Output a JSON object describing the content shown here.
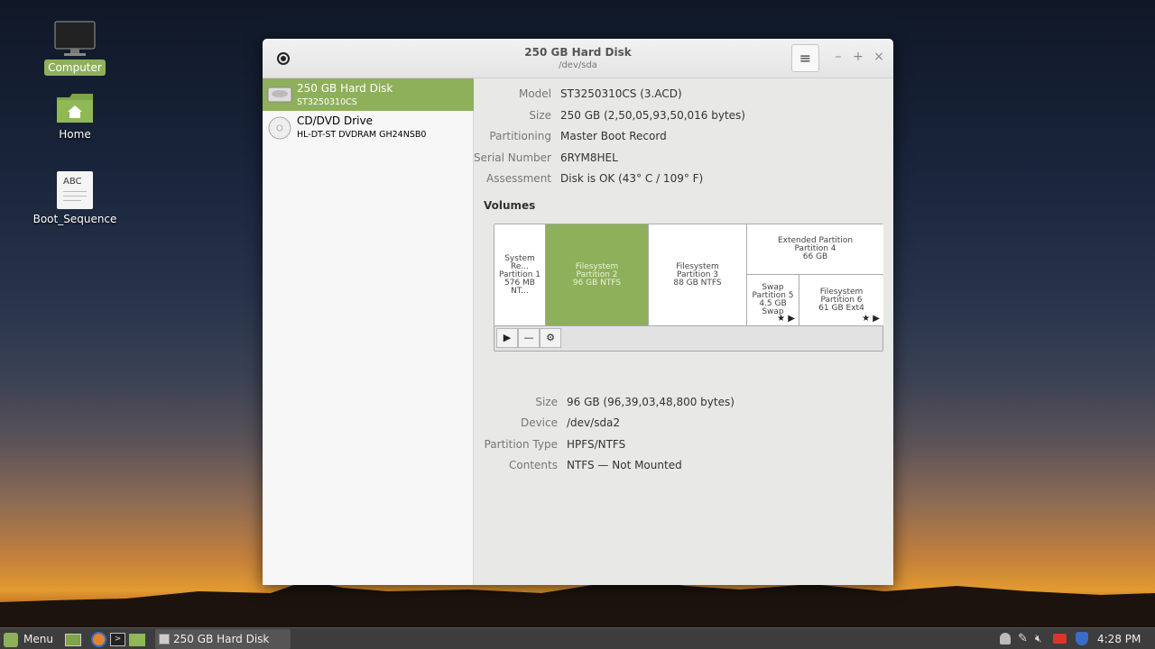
{
  "desktop": {
    "icons": [
      {
        "label": "Computer",
        "icon": "monitor-icon"
      },
      {
        "label": "Home",
        "icon": "home-folder-icon"
      },
      {
        "label": "Boot_Sequence",
        "icon": "text-file-icon",
        "thumb": "ABC"
      }
    ]
  },
  "window": {
    "title": "250 GB Hard Disk",
    "subtitle": "/dev/sda",
    "menu_icon": "hamburger-icon",
    "controls": [
      "–",
      "+",
      "×"
    ]
  },
  "sidebar": {
    "drives": [
      {
        "name": "250 GB Hard Disk",
        "model": "ST3250310CS",
        "icon": "harddisk-icon",
        "selected": true
      },
      {
        "name": "CD/DVD Drive",
        "model": "HL-DT-ST DVDRAM GH24NSB0",
        "icon": "optical-disc-icon",
        "selected": false
      }
    ]
  },
  "disk_info": {
    "model_label": "Model",
    "model": "ST3250310CS (3.ACD)",
    "size_label": "Size",
    "size": "250 GB (2,50,05,93,50,016 bytes)",
    "partitioning_label": "Partitioning",
    "partitioning": "Master Boot Record",
    "serial_label": "Serial Number",
    "serial": "6RYM8HEL",
    "assessment_label": "Assessment",
    "assessment": "Disk is OK (43° C / 109° F)"
  },
  "volumes": {
    "title": "Volumes",
    "partitions": [
      {
        "l1": "System Re...",
        "l2": "Partition 1",
        "l3": "576 MB NT..."
      },
      {
        "l1": "Filesystem",
        "l2": "Partition 2",
        "l3": "96 GB NTFS",
        "selected": true
      },
      {
        "l1": "Filesystem",
        "l2": "Partition 3",
        "l3": "88 GB NTFS"
      },
      {
        "l1": "Extended Partition",
        "l2": "Partition 4",
        "l3": "66 GB"
      },
      {
        "l1": "Swap",
        "l2": "Partition 5",
        "l3": "4.5 GB Swap",
        "glyphs": "★ ▶"
      },
      {
        "l1": "Filesystem",
        "l2": "Partition 6",
        "l3": "61 GB Ext4",
        "glyphs": "★ ▶"
      }
    ],
    "toolbar": {
      "play": "▶",
      "minus": "—",
      "gear": "⚙"
    }
  },
  "selected_volume": {
    "size_label": "Size",
    "size": "96 GB (96,39,03,48,800 bytes)",
    "device_label": "Device",
    "device": "/dev/sda2",
    "ptype_label": "Partition Type",
    "ptype": "HPFS/NTFS",
    "contents_label": "Contents",
    "contents": "NTFS — Not Mounted"
  },
  "taskbar": {
    "menu_label": "Menu",
    "window_label": "250 GB Hard Disk",
    "clock": "4:28 PM"
  },
  "colors": {
    "accent": "#8fb05a",
    "taskbar": "#3d3d3d"
  }
}
